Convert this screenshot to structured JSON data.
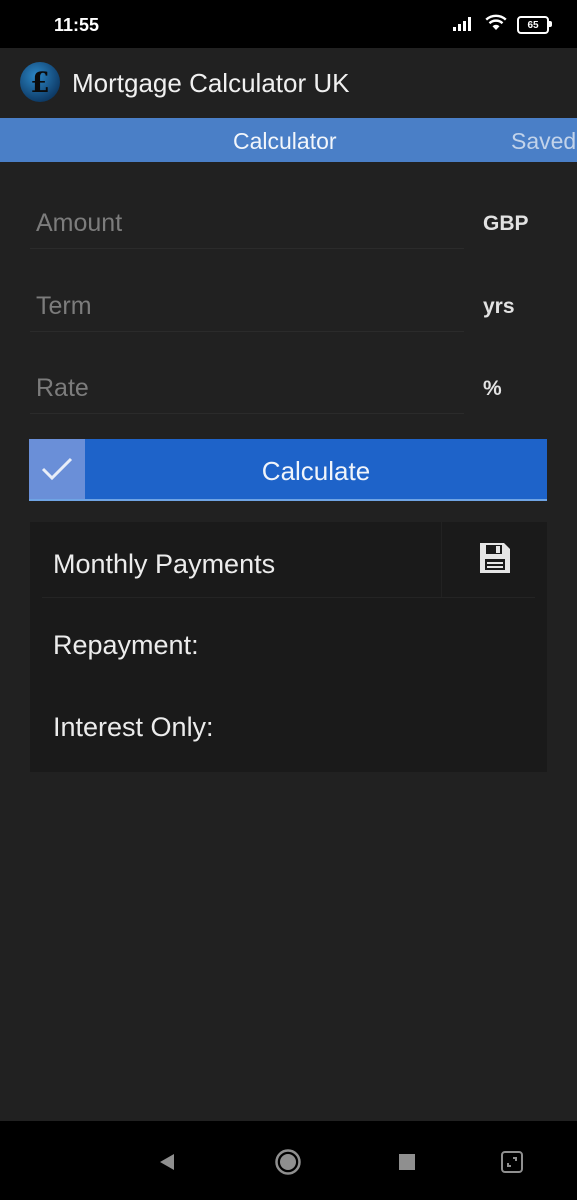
{
  "status_bar": {
    "time": "11:55",
    "battery": "65",
    "icons": [
      "signal-icon",
      "wifi-icon",
      "battery-icon"
    ]
  },
  "app_bar": {
    "logo_symbol": "£",
    "title": "Mortgage Calculator UK"
  },
  "tabs": [
    {
      "label": "Calculator",
      "active": true
    },
    {
      "label": "Saved",
      "active": false
    }
  ],
  "form": {
    "amount": {
      "placeholder": "Amount",
      "value": "",
      "unit": "GBP"
    },
    "term": {
      "placeholder": "Term",
      "value": "",
      "unit": "yrs"
    },
    "rate": {
      "placeholder": "Rate",
      "value": "",
      "unit": "%"
    }
  },
  "calculate_button": {
    "label": "Calculate",
    "icon": "checkmark-icon"
  },
  "results": {
    "title": "Monthly Payments",
    "save_icon": "save-icon",
    "repayment_label": "Repayment:",
    "interest_only_label": "Interest Only:"
  },
  "navigation": {
    "icons": [
      "back-icon",
      "home-icon",
      "recents-icon",
      "screenshot-icon"
    ]
  },
  "colors": {
    "background": "#212121",
    "tab_bar": "#4a7fc7",
    "button": "#1e63c9",
    "button_icon_bg": "#6a8fd8",
    "results_card": "#1a1a1a"
  }
}
